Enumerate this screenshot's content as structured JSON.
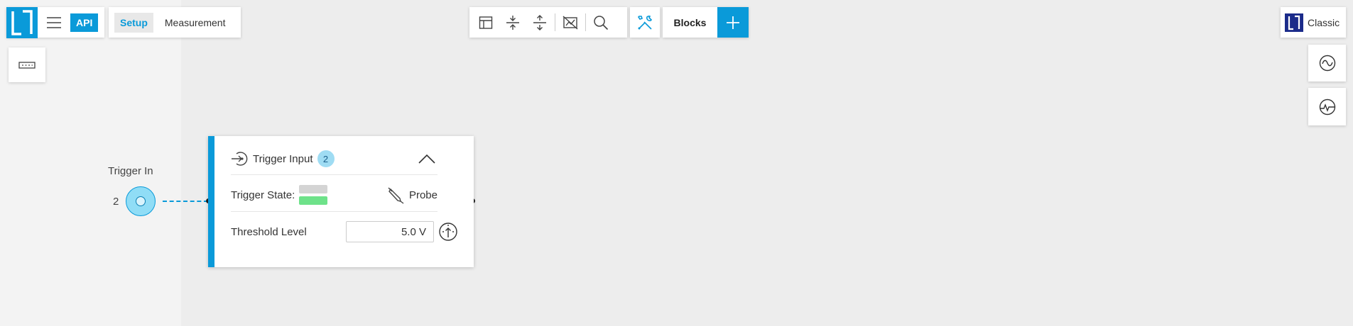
{
  "app": {
    "api_label": "API",
    "modes": [
      "Setup",
      "Measurement"
    ],
    "active_mode": "Setup"
  },
  "toolbar": {
    "icons": [
      "layout-icon",
      "collapse-vertical-icon",
      "expand-vertical-icon",
      "hide-chart-icon",
      "search-icon"
    ],
    "blocks_label": "Blocks",
    "add_icon": "plus-icon"
  },
  "right_panel": {
    "classic_label": "Classic",
    "buttons": [
      "oscilloscope-icon",
      "meter-icon"
    ]
  },
  "port": {
    "label": "Trigger In",
    "number": "2"
  },
  "block": {
    "title": "Trigger Input",
    "badge": "2",
    "trigger_state_label": "Trigger State:",
    "probe_label": "Probe",
    "threshold_label": "Threshold Level",
    "threshold_value": "5.0 V",
    "state_colors": [
      "#d4d4d4",
      "#6ee28a"
    ]
  },
  "colors": {
    "accent": "#0a9ad9",
    "brand_dark": "#1b2b8a"
  }
}
